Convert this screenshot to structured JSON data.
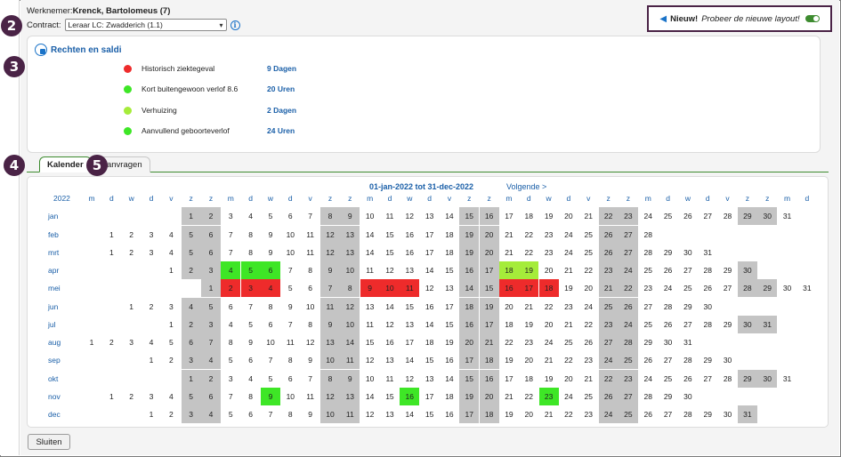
{
  "employee": {
    "label": "Werknemer:",
    "name": "Krenck, Bartolomeus (7)"
  },
  "contract": {
    "label": "Contract:",
    "selected": "Leraar LC: Zwadderich (1.1)"
  },
  "new_layout": {
    "strong": "Nieuw!",
    "text": "Probeer de nieuwe layout!"
  },
  "badges": [
    "2",
    "3",
    "4",
    "5"
  ],
  "rights": {
    "title": "Rechten en saldi",
    "items": [
      {
        "label": "Historisch ziektegeval",
        "value": "9 Dagen",
        "color": "#ee2b2b"
      },
      {
        "label": "Kort buitengewoon verlof 8.6",
        "value": "20 Uren",
        "color": "#3ee626"
      },
      {
        "label": "Verhuizing",
        "value": "2 Dagen",
        "color": "#a5ec3a"
      },
      {
        "label": "Aanvullend geboorteverlof",
        "value": "24 Uren",
        "color": "#3ee626"
      }
    ]
  },
  "tabs": [
    {
      "label": "Kalender",
      "active": true
    },
    {
      "label": "Aanvragen",
      "active": false
    }
  ],
  "calendar": {
    "range": "01-jan-2022 tot 31-dec-2022",
    "next": "Volgende >",
    "year": "2022",
    "weekday_labels": [
      "m",
      "d",
      "w",
      "d",
      "v",
      "z",
      "z"
    ],
    "months": [
      "jan",
      "feb",
      "mrt",
      "apr",
      "mei",
      "jun",
      "jul",
      "aug",
      "sep",
      "okt",
      "nov",
      "dec"
    ],
    "highlights": [
      {
        "month": 4,
        "day": 4,
        "type": "green"
      },
      {
        "month": 4,
        "day": 5,
        "type": "green"
      },
      {
        "month": 4,
        "day": 6,
        "type": "green"
      },
      {
        "month": 4,
        "day": 18,
        "type": "lime"
      },
      {
        "month": 4,
        "day": 19,
        "type": "lime"
      },
      {
        "month": 5,
        "day": 2,
        "type": "red"
      },
      {
        "month": 5,
        "day": 3,
        "type": "red"
      },
      {
        "month": 5,
        "day": 4,
        "type": "red"
      },
      {
        "month": 5,
        "day": 9,
        "type": "red"
      },
      {
        "month": 5,
        "day": 10,
        "type": "red"
      },
      {
        "month": 5,
        "day": 11,
        "type": "red"
      },
      {
        "month": 5,
        "day": 16,
        "type": "red"
      },
      {
        "month": 5,
        "day": 17,
        "type": "red"
      },
      {
        "month": 5,
        "day": 18,
        "type": "red"
      },
      {
        "month": 11,
        "day": 9,
        "type": "green"
      },
      {
        "month": 11,
        "day": 16,
        "type": "green"
      },
      {
        "month": 11,
        "day": 23,
        "type": "green"
      }
    ]
  },
  "close_button": "Sluiten"
}
